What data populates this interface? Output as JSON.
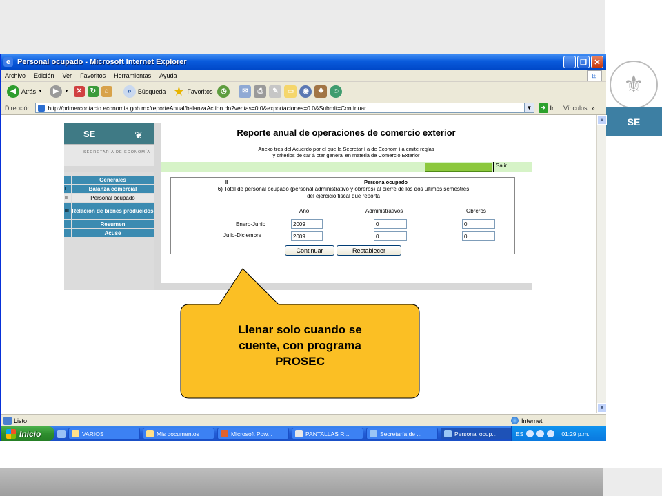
{
  "window": {
    "title": "Personal ocupado - Microsoft Internet Explorer",
    "menu": [
      "Archivo",
      "Edición",
      "Ver",
      "Favoritos",
      "Herramientas",
      "Ayuda"
    ],
    "toolbar": {
      "back": "Atrás",
      "search": "Búsqueda",
      "favorites": "Favoritos"
    },
    "address_label": "Dirección",
    "url": "http://primercontacto.economia.gob.mx/reporteAnual/balanzaAction.do?ventas=0.0&exportaciones=0.0&Submit=Continuar",
    "go": "Ir",
    "links": "Vínculos",
    "status": "Listo",
    "zone": "Internet"
  },
  "page": {
    "logo": "SE",
    "logo_sub": "SECRETARÍA DE ECONOMÍA",
    "title": "Reporte anual de operaciones de comercio exterior",
    "subtitle_1": "Anexo tres del Acuerdo por el que la Secretar í a de Econom í a emite reglas",
    "subtitle_2": "y criterios de car á cter general en materia de Comercio Exterior",
    "exit": "Salir",
    "nav": [
      {
        "num": "",
        "label": "Generales"
      },
      {
        "num": "I",
        "label": "Balanza comercial"
      },
      {
        "num": "II",
        "label": "Personal ocupado"
      },
      {
        "num": "III",
        "label": "Relacion de bienes producidos"
      },
      {
        "num": "",
        "label": "Resumen"
      },
      {
        "num": "",
        "label": "Acuse"
      }
    ],
    "form": {
      "section": "II",
      "section_title": "Persona ocupado",
      "question_1": "6)  Total de personal ocupado (personal administrativo y obreros) al cierre de los dos últimos semestres",
      "question_2": "del ejercicio fiscal que reporta",
      "col_year": "Año",
      "col_admin": "Administrativos",
      "col_workers": "Obreros",
      "rows": [
        {
          "label": "Enero-Junio",
          "year": "2009",
          "admin": "0",
          "workers": "0"
        },
        {
          "label": "Julio-Diciembre",
          "year": "2009",
          "admin": "0",
          "workers": "0"
        }
      ],
      "continue": "Continuar",
      "reset": "Restablecer"
    }
  },
  "taskbar": {
    "start": "Inicio",
    "tasks": [
      "VARIOS",
      "Mis documentos",
      "Microsoft Pow...",
      "PANTALLAS R...",
      "Secretaría de ...",
      "Personal ocup..."
    ],
    "lang": "ES",
    "clock": "01:29 p.m."
  },
  "callout": {
    "line1": "Llenar solo cuando se",
    "line2": "cuente, con programa",
    "line3": "PROSEC",
    "fill": "#fbbf24"
  },
  "slide": {
    "brand": "SE"
  }
}
